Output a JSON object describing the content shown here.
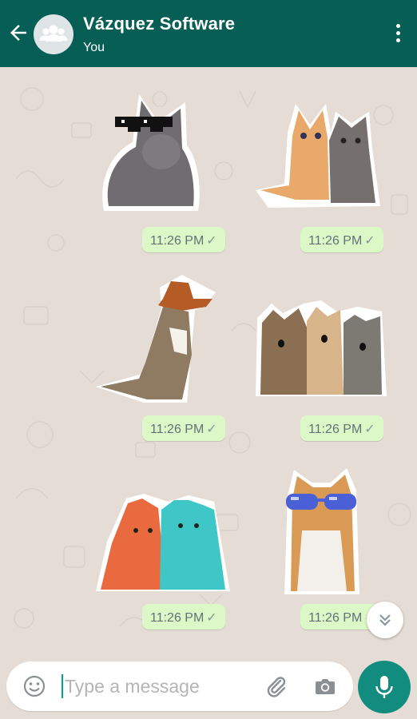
{
  "header": {
    "title": "Vázquez Software",
    "subtitle": "You"
  },
  "messages": [
    {
      "time": "11:26 PM",
      "status": "✓",
      "sticker": "cat-with-pixel-sunglasses"
    },
    {
      "time": "11:26 PM",
      "status": "✓",
      "sticker": "two-kittens-looking-up"
    },
    {
      "time": "11:26 PM",
      "status": "✓",
      "sticker": "cat-with-cowboy-hat"
    },
    {
      "time": "11:26 PM",
      "status": "✓",
      "sticker": "three-surprised-cats"
    },
    {
      "time": "11:26 PM",
      "status": "✓",
      "sticker": "orange-and-teal-persian-cats"
    },
    {
      "time": "11:26 PM",
      "status": "✓",
      "sticker": "cat-with-blue-sunglasses"
    }
  ],
  "input": {
    "placeholder": "Type a message",
    "value": ""
  },
  "icons": {
    "back": "arrow-left-icon",
    "avatar": "group-avatar-icon",
    "menu": "more-vertical-icon",
    "scroll": "double-chevron-down-icon",
    "emoji": "emoji-icon",
    "attach": "paperclip-icon",
    "camera": "camera-icon",
    "mic": "microphone-icon"
  },
  "colors": {
    "header": "#075e54",
    "chat_background": "#e5ddd5",
    "outgoing_bubble": "#dcf8c6",
    "mic_button": "#128c7e"
  }
}
